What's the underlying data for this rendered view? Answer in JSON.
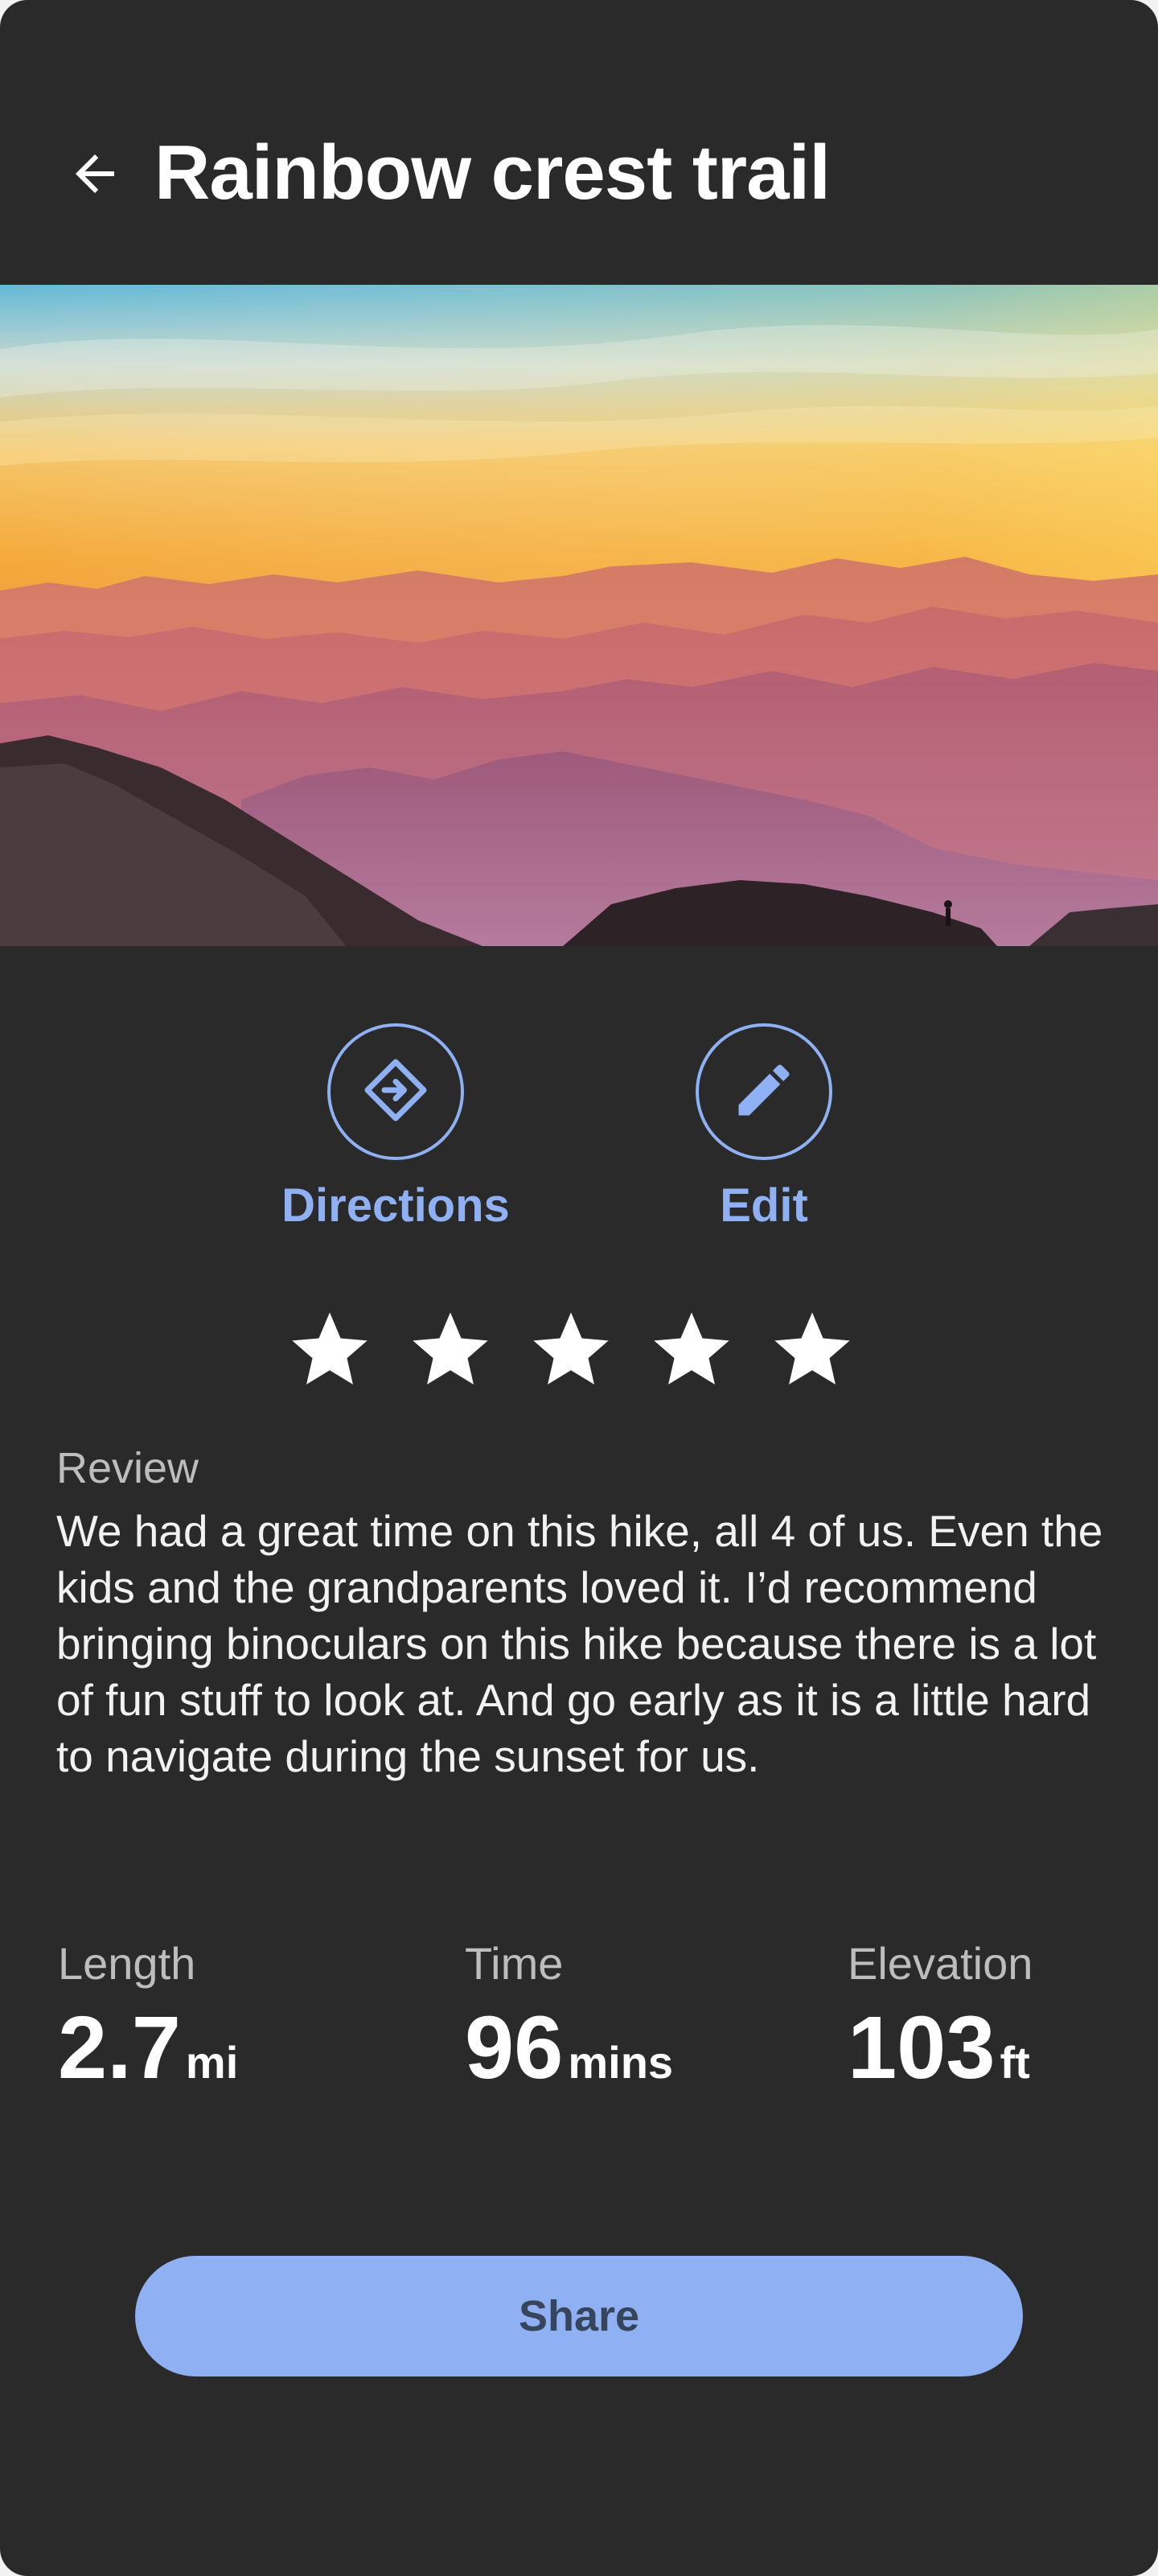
{
  "header": {
    "title": "Rainbow crest trail",
    "back_icon": "arrow-left-icon"
  },
  "actions": [
    {
      "label": "Directions",
      "icon": "directions-icon"
    },
    {
      "label": "Edit",
      "icon": "pencil-icon"
    }
  ],
  "rating": {
    "value": 5,
    "max": 5
  },
  "review": {
    "label": "Review",
    "text": "We had a great time on this hike, all 4 of us.  Even the kids and the grandparents loved it.  I’d recommend bringing binoculars on this hike because there is a lot of fun stuff to look at.  And go early as it is a little hard to navigate during the sunset for us."
  },
  "stats": [
    {
      "label": "Length",
      "value": "2.7",
      "unit": "mi"
    },
    {
      "label": "Time",
      "value": "96",
      "unit": "mins"
    },
    {
      "label": "Elevation",
      "value": "103",
      "unit": "ft"
    }
  ],
  "share": {
    "label": "Share"
  },
  "colors": {
    "background": "#2a2a2a",
    "accent": "#8fb0f2",
    "button_text": "#36455c"
  }
}
